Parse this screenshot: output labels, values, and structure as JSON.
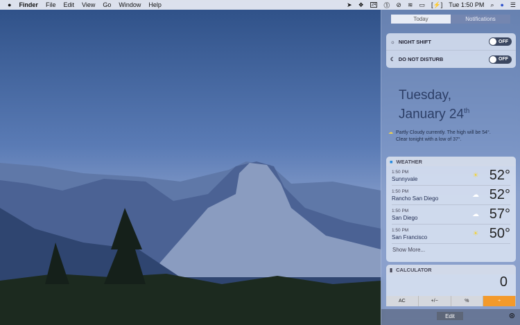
{
  "menubar": {
    "apple": "",
    "app": "Finder",
    "items": [
      "File",
      "Edit",
      "View",
      "Go",
      "Window",
      "Help"
    ],
    "clock": "Tue 1:50 PM",
    "calendar_day": "24"
  },
  "panel": {
    "tabs": [
      "Today",
      "Notifications"
    ],
    "toggles": [
      {
        "label": "NIGHT SHIFT",
        "state": "OFF"
      },
      {
        "label": "DO NOT DISTURB",
        "state": "OFF"
      }
    ],
    "date_line1": "Tuesday,",
    "date_line2": "January 24",
    "date_suffix": "th",
    "forecast": [
      "Partly Cloudy currently. The high will be 54°.",
      "Clear tonight with a low of 37°."
    ],
    "weather": {
      "title": "WEATHER",
      "rows": [
        {
          "time": "1:50 PM",
          "city": "Sunnyvale",
          "icon": "sun-icon",
          "temp": "52°"
        },
        {
          "time": "1:50 PM",
          "city": "Rancho San Diego",
          "icon": "cloud-icon",
          "temp": "52°"
        },
        {
          "time": "1:50 PM",
          "city": "San Diego",
          "icon": "cloud-icon",
          "temp": "57°"
        },
        {
          "time": "1:50 PM",
          "city": "San Francisco",
          "icon": "sun-icon",
          "temp": "50°"
        }
      ],
      "show_more": "Show More..."
    },
    "calculator": {
      "title": "CALCULATOR",
      "display": "0",
      "keys": [
        "AC",
        "+/−",
        "%",
        "÷"
      ]
    },
    "edit": "Edit"
  }
}
